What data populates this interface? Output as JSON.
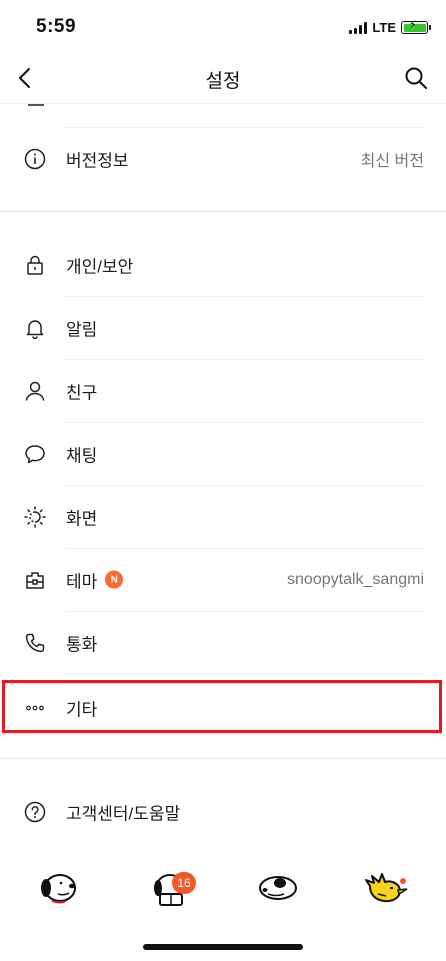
{
  "status_bar": {
    "time": "5:59",
    "network": "LTE",
    "battery_color": "#38c531"
  },
  "nav": {
    "title": "설정",
    "back_icon": "chevron-left-icon",
    "search_icon": "search-icon"
  },
  "version_row": {
    "icon": "info-circle-icon",
    "label": "버전정보",
    "value": "최신 버전"
  },
  "menu": {
    "privacy": {
      "icon": "lock-icon",
      "label": "개인/보안"
    },
    "notifications": {
      "icon": "bell-icon",
      "label": "알림"
    },
    "friends": {
      "icon": "person-icon",
      "label": "친구"
    },
    "chats": {
      "icon": "speech-bubble-icon",
      "label": "채팅"
    },
    "display": {
      "icon": "brightness-icon",
      "label": "화면"
    },
    "theme": {
      "icon": "theme-bag-icon",
      "label": "테마",
      "badge": "N",
      "value": "snoopytalk_sangmi"
    },
    "calls": {
      "icon": "phone-icon",
      "label": "통화"
    },
    "etc": {
      "icon": "more-dots-icon",
      "label": "기타"
    }
  },
  "help_row": {
    "icon": "question-circle-icon",
    "label": "고객센터/도움말"
  },
  "tab_bar": {
    "tabs": [
      {
        "name": "friends-tab",
        "icon": "snoopy-face-icon"
      },
      {
        "name": "chats-tab",
        "icon": "snoopy-reading-icon",
        "badge": "16"
      },
      {
        "name": "view-tab",
        "icon": "snoopy-lying-icon"
      },
      {
        "name": "more-tab",
        "icon": "woodstock-icon",
        "dot": true
      }
    ]
  },
  "colors": {
    "highlight": "#e31c24",
    "badge": "#ff6a2c"
  }
}
